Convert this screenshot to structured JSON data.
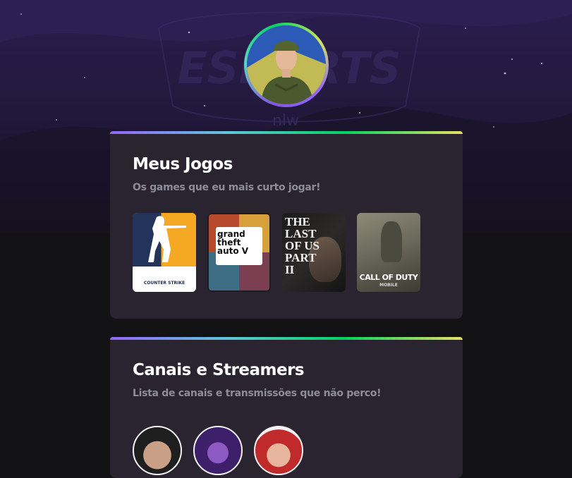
{
  "profile": {
    "avatar_alt": "avatar"
  },
  "background": {
    "watermark_text": "ESPORTS",
    "watermark_sub": "nlw"
  },
  "games_section": {
    "title": "Meus Jogos",
    "subtitle": "Os games que eu mais curto jogar!",
    "games": [
      {
        "label": "COUNTER STRIKE"
      },
      {
        "label": "grand theft auto V"
      },
      {
        "label": "THE LAST OF US PART II"
      },
      {
        "label": "CALL OF DUTY",
        "sub": "MOBILE"
      }
    ]
  },
  "streamers_section": {
    "title": "Canais e Streamers",
    "subtitle": "Lista de canais e transmissões que não perco!",
    "streamers": [
      {
        "name": "streamer-1"
      },
      {
        "name": "streamer-2"
      },
      {
        "name": "streamer-3"
      }
    ]
  },
  "colors": {
    "background": "#121214",
    "card": "#29242f",
    "accent_gradient": [
      "#9466ff",
      "#5ec7d7",
      "#04d361",
      "#e5e163"
    ],
    "title": "#ffffff",
    "subtitle": "#8d8d99"
  }
}
